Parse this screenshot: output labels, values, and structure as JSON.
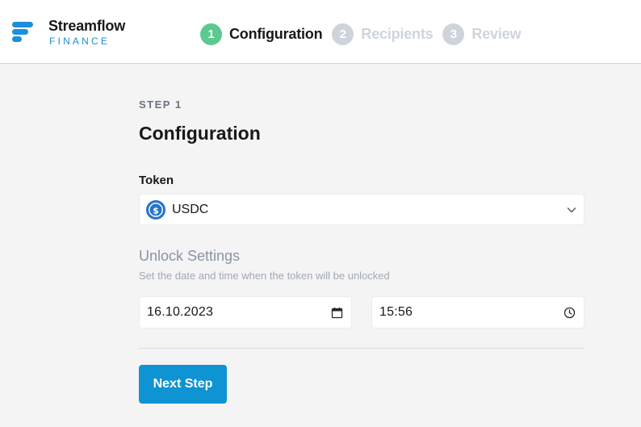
{
  "brand": {
    "name": "Streamflow",
    "sub": "FINANCE",
    "accent": "#1c8fd9"
  },
  "stepper": {
    "steps": [
      {
        "number": "1",
        "label": "Configuration",
        "active": true
      },
      {
        "number": "2",
        "label": "Recipients",
        "active": false
      },
      {
        "number": "3",
        "label": "Review",
        "active": false
      }
    ],
    "active_color": "#5cc98f",
    "active_text_color": "#18181b",
    "inactive_color": "#cfd4dc",
    "inactive_text_color": "#cfd4dc"
  },
  "form": {
    "eyebrow": "STEP 1",
    "title": "Configuration",
    "token_label": "Token",
    "token_value": "USDC",
    "token_icon": "usdc-coin-icon",
    "unlock_title": "Unlock Settings",
    "unlock_desc": "Set the date and time when the token will be unlocked",
    "date_value": "16.10.2023",
    "time_value": "15:56",
    "next_label": "Next Step"
  },
  "colors": {
    "primary_button": "#0e93d3",
    "usdc": "#2775ca"
  }
}
